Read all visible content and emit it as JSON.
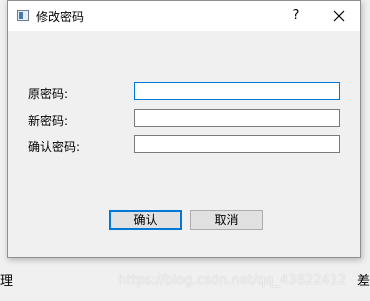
{
  "background": {
    "left_text": "理",
    "right_text": "差"
  },
  "dialog": {
    "title": "修改密码",
    "help_label": "?",
    "fields": [
      {
        "label": "原密码:",
        "value": "",
        "placeholder": ""
      },
      {
        "label": "新密码:",
        "value": "",
        "placeholder": ""
      },
      {
        "label": "确认密码:",
        "value": "",
        "placeholder": ""
      }
    ],
    "buttons": {
      "confirm": "确认",
      "cancel": "取消"
    }
  },
  "watermark": "https://blog.csdn.net/qq_43822412",
  "colors": {
    "focus_border": "#0078d7",
    "dialog_bg": "#f0f0f0",
    "titlebar_bg": "#ffffff"
  },
  "icons": {
    "window_icon": "app-window-icon",
    "close": "close-icon",
    "help": "help-icon"
  }
}
